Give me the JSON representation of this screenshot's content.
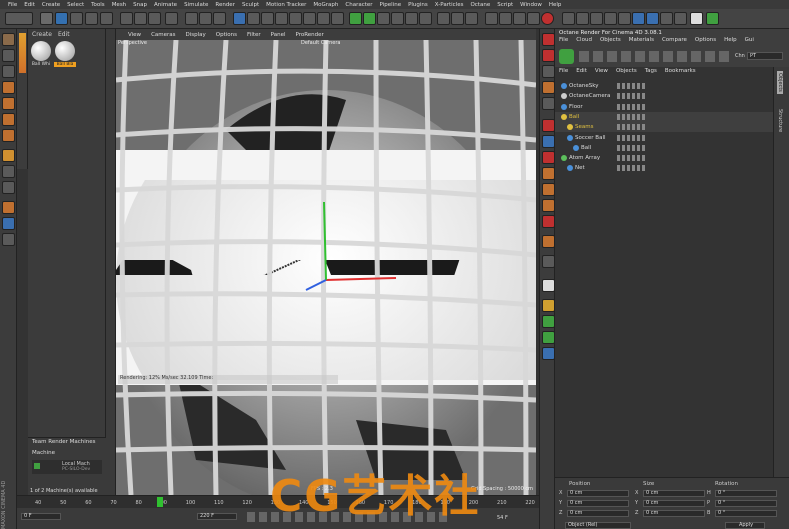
{
  "menubar": [
    "File",
    "Edit",
    "Create",
    "Select",
    "Tools",
    "Mesh",
    "Snap",
    "Animate",
    "Simulate",
    "Render",
    "Sculpt",
    "Motion Tracker",
    "MoGraph",
    "Character",
    "Pipeline",
    "Plugins",
    "X-Particles",
    "Octane",
    "Script",
    "Window",
    "Help"
  ],
  "material_panel": {
    "menu": [
      "Create",
      "Edit"
    ],
    "materials": [
      "Ball Whi",
      "Ball Bla"
    ]
  },
  "viewport": {
    "menu": [
      "View",
      "Cameras",
      "Display",
      "Options",
      "Filter",
      "Panel",
      "ProRender"
    ],
    "name": "Perspective",
    "camera": "Default Camera",
    "render_status": "Rendering: 12% Ms/sec 32.109 Time:",
    "fps": "FPS : 2.3",
    "grid": "Grid Spacing : 50000 cm"
  },
  "octane": {
    "title": "Octane Render For Cinema 4D 3.08.1",
    "menu": [
      "File",
      "Cloud",
      "Objects",
      "Materials",
      "Compare",
      "Options",
      "Help",
      "Gui"
    ],
    "channel_label": "Chn",
    "channel_value": "PT"
  },
  "object_manager": {
    "menu": [
      "File",
      "Edit",
      "View",
      "Objects",
      "Tags",
      "Bookmarks"
    ],
    "objects": [
      {
        "name": "OctaneSky",
        "color": "#4a90d9"
      },
      {
        "name": "OctaneCamera",
        "color": "#cccccc"
      },
      {
        "name": "Floor",
        "color": "#4a90d9"
      },
      {
        "name": "Ball",
        "color": "#e0c040"
      },
      {
        "name": "Seams",
        "color": "#e0c040"
      },
      {
        "name": "Soccer Ball",
        "color": "#4a90d9"
      },
      {
        "name": "Ball",
        "color": "#4a90d9"
      },
      {
        "name": "Atom Array",
        "color": "#5cbf5c"
      },
      {
        "name": "Net",
        "color": "#4a90d9"
      }
    ]
  },
  "right_tabs": [
    "Objects",
    "Structure"
  ],
  "left_brand": "MAXON CINEMA 4D",
  "team_render": {
    "title": "Team Render Machines",
    "col": "Machine",
    "machine": "Local Mach",
    "machine_sub": "PC-SILO-Dev",
    "status": "1 of 2 Machine(s) available"
  },
  "timeline": {
    "ticks": [
      "40",
      "50",
      "60",
      "70",
      "80",
      "90",
      "100",
      "110",
      "120",
      "130",
      "140",
      "150",
      "160",
      "170",
      "180",
      "190",
      "200",
      "210",
      "220"
    ],
    "frame_left": "0 F",
    "frame_right": "220 F",
    "current_frame": "54 F"
  },
  "coords": {
    "headers": [
      "Position",
      "Size",
      "Rotation"
    ],
    "rows": [
      [
        "X",
        "0 cm",
        "X",
        "0 cm",
        "H",
        "0 °"
      ],
      [
        "Y",
        "0 cm",
        "Y",
        "0 cm",
        "P",
        "0 °"
      ],
      [
        "Z",
        "0 cm",
        "Z",
        "0 cm",
        "B",
        "0 °"
      ]
    ],
    "mode": "Object (Rel)",
    "apply": "Apply"
  },
  "watermark": "CG艺术社",
  "colors": {
    "accent": "#f0a020",
    "selected": "#e0c040"
  }
}
